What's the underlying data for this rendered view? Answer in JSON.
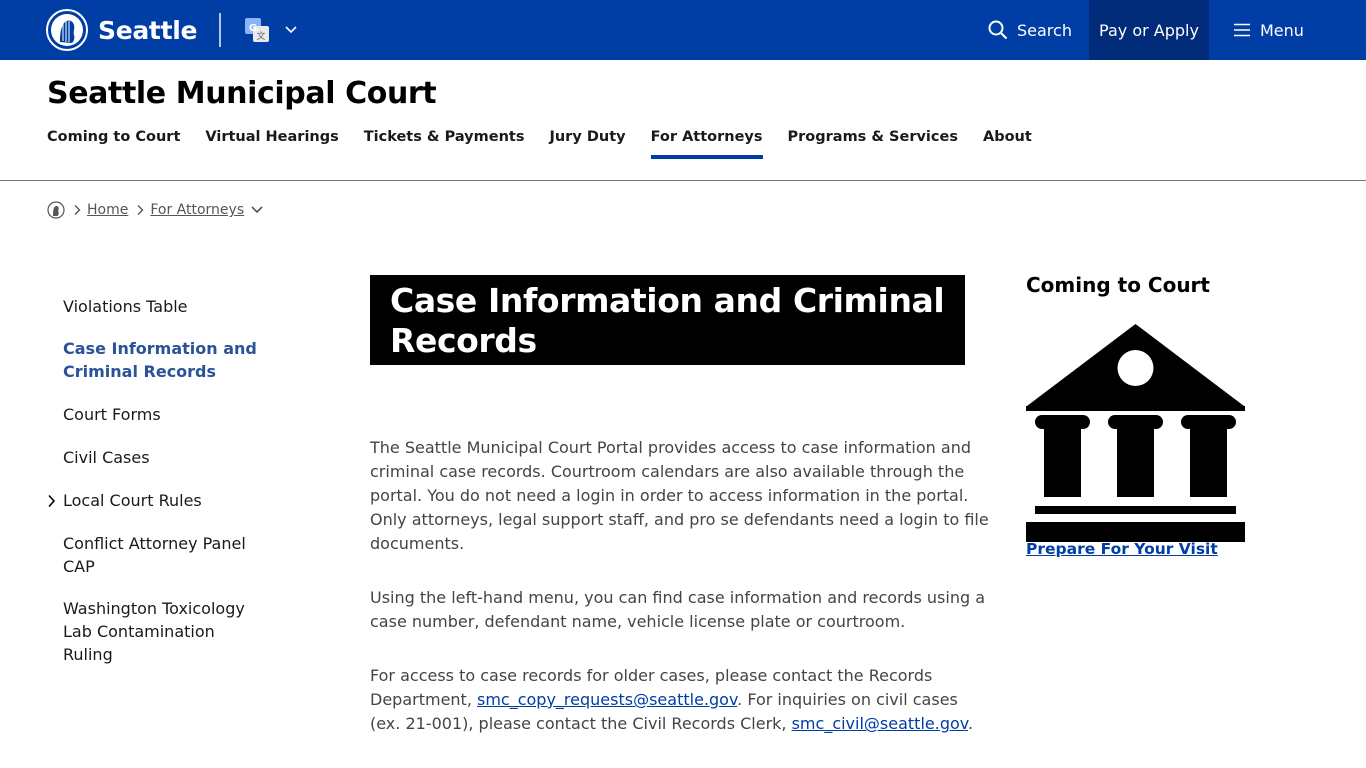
{
  "topbar": {
    "logo_text": "Seattle",
    "search_label": "Search",
    "pay_label": "Pay or Apply",
    "menu_label": "Menu",
    "icons": [
      "seattle-seal-icon",
      "google-translate-icon",
      "chevron-down-icon",
      "search-icon",
      "hamburger-menu-icon"
    ]
  },
  "site": {
    "title": "Seattle Municipal Court"
  },
  "mainnav": {
    "items": [
      {
        "label": "Coming to Court",
        "active": false
      },
      {
        "label": "Virtual Hearings",
        "active": false
      },
      {
        "label": "Tickets & Payments",
        "active": false
      },
      {
        "label": "Jury Duty",
        "active": false
      },
      {
        "label": "For Attorneys",
        "active": true
      },
      {
        "label": "Programs & Services",
        "active": false
      },
      {
        "label": "About",
        "active": false
      }
    ]
  },
  "breadcrumb": {
    "home": "Home",
    "section": "For Attorneys"
  },
  "leftnav": {
    "items": [
      {
        "label": "Violations Table",
        "active": false
      },
      {
        "label": "Case Information and Criminal Records",
        "active": true
      },
      {
        "label": "Court Forms",
        "active": false
      },
      {
        "label": "Civil Cases",
        "active": false
      },
      {
        "label": "Local Court Rules",
        "active": false,
        "expandable": true
      },
      {
        "label": "Conflict Attorney Panel CAP",
        "active": false
      },
      {
        "label": "Washington Toxicology Lab Contamination Ruling",
        "active": false
      }
    ]
  },
  "main": {
    "heading": "Case Information and Criminal Records",
    "p1": "The Seattle Municipal Court Portal provides access to case information and criminal case records. Courtroom calendars are also available through the portal. You do not need a login in order to access information in the portal. Only attorneys, legal support staff, and pro se defendants need a login to file documents.",
    "p2": "Using the left-hand menu, you can find case information and records using a case number, defendant name, vehicle license plate or courtroom.",
    "p3_part1": "For access to case records for older cases, please contact the Records Department, ",
    "p3_link1": "smc_copy_requests@seattle.gov",
    "p3_part2": ". For inquiries on civil cases (ex. 21-001), please contact the Civil Records Clerk, ",
    "p3_link2": "smc_civil@seattle.gov",
    "p3_part3": "."
  },
  "sidebar": {
    "title": "Coming to Court",
    "icon": "courthouse-icon",
    "link": "Prepare For Your Visit"
  },
  "colors": {
    "brand_blue": "#003da5",
    "pay_bg": "#002b79",
    "heading_bg": "#000000",
    "active_nav_text": "#2a5298"
  }
}
